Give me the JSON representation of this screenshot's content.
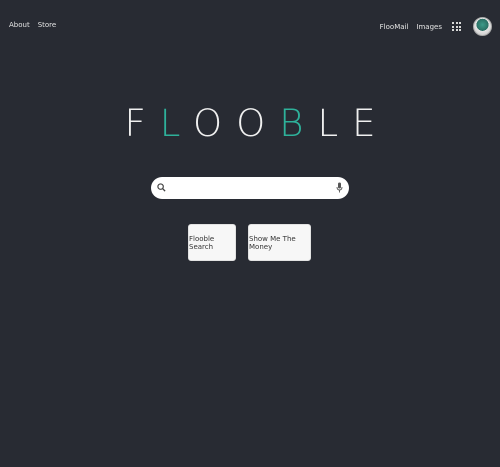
{
  "nav": {
    "about": "About",
    "store": "Store",
    "mail": "FlooMail",
    "images": "Images",
    "apps_icon": "apps-grid-icon",
    "avatar_icon": "user-avatar"
  },
  "logo": {
    "letters": [
      "F",
      "L",
      "O",
      "O",
      "B",
      "L",
      "E"
    ],
    "accent_color": "#2eb19a",
    "text_color": "#f0f0f0"
  },
  "search": {
    "value": "",
    "placeholder": "",
    "search_icon": "search-icon",
    "mic_icon": "microphone-icon"
  },
  "buttons": {
    "search_label": "Flooble Search",
    "lucky_label": "Show Me The Money"
  },
  "colors": {
    "background": "#282b33",
    "accent": "#2eb19a"
  }
}
